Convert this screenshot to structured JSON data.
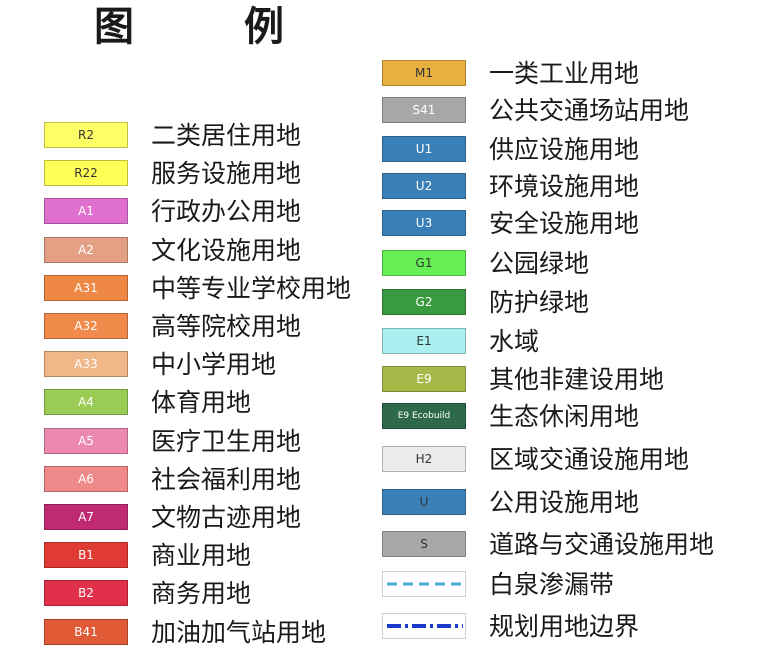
{
  "legend": {
    "title_1": "图",
    "title_2": "例",
    "left_items": [
      {
        "code": "R2",
        "label": "二类居住用地",
        "color": "#ffff66",
        "text_color": "dark"
      },
      {
        "code": "R22",
        "label": "服务设施用地",
        "color": "#ffff55",
        "text_color": "dark"
      },
      {
        "code": "A1",
        "label": "行政办公用地",
        "color": "#e070cf",
        "text_color": "light"
      },
      {
        "code": "A2",
        "label": "文化设施用地",
        "color": "#e4a084",
        "text_color": "light"
      },
      {
        "code": "A31",
        "label": "中等专业学校用地",
        "color": "#ee8844",
        "text_color": "light"
      },
      {
        "code": "A32",
        "label": "高等院校用地",
        "color": "#f08a4a",
        "text_color": "light"
      },
      {
        "code": "A33",
        "label": "中小学用地",
        "color": "#f0b888",
        "text_color": "light"
      },
      {
        "code": "A4",
        "label": "体育用地",
        "color": "#9acc55",
        "text_color": "light"
      },
      {
        "code": "A5",
        "label": "医疗卫生用地",
        "color": "#ec88b0",
        "text_color": "light"
      },
      {
        "code": "A6",
        "label": "社会福利用地",
        "color": "#f08a8a",
        "text_color": "light"
      },
      {
        "code": "A7",
        "label": "文物古迹用地",
        "color": "#c02a70",
        "text_color": "light"
      },
      {
        "code": "B1",
        "label": "商业用地",
        "color": "#e03a35",
        "text_color": "light"
      },
      {
        "code": "B2",
        "label": "商务用地",
        "color": "#e0304a",
        "text_color": "light"
      },
      {
        "code": "B41",
        "label": "加油加气站用地",
        "color": "#e05a35",
        "text_color": "light"
      }
    ],
    "right_items": [
      {
        "code": "M1",
        "label": "一类工业用地",
        "color": "#e8b040",
        "text_color": "dark",
        "kind": "fill"
      },
      {
        "code": "S41",
        "label": "公共交通场站用地",
        "color": "#a8a8a8",
        "text_color": "light",
        "kind": "fill"
      },
      {
        "code": "U1",
        "label": "供应设施用地",
        "color": "#3a80b8",
        "text_color": "light",
        "kind": "fill"
      },
      {
        "code": "U2",
        "label": "环境设施用地",
        "color": "#3a80b8",
        "text_color": "light",
        "kind": "fill"
      },
      {
        "code": "U3",
        "label": "安全设施用地",
        "color": "#3a80b8",
        "text_color": "light",
        "kind": "fill"
      },
      {
        "code": "G1",
        "label": "公园绿地",
        "color": "#66ee55",
        "text_color": "dark",
        "kind": "fill"
      },
      {
        "code": "G2",
        "label": "防护绿地",
        "color": "#3a9a40",
        "text_color": "light",
        "kind": "fill"
      },
      {
        "code": "E1",
        "label": "水域",
        "color": "#aaf0f0",
        "text_color": "dark",
        "kind": "fill"
      },
      {
        "code": "E9",
        "label": "其他非建设用地",
        "color": "#a8b848",
        "text_color": "light",
        "kind": "fill"
      },
      {
        "code": "E9 Ecobuild",
        "label": "生态休闲用地",
        "color": "#2e6a4a",
        "text_color": "light",
        "kind": "fill"
      },
      {
        "code": "H2",
        "label": "区域交通设施用地",
        "color": "#ebebeb",
        "text_color": "dark",
        "kind": "fill"
      },
      {
        "code": "U",
        "label": "公用设施用地",
        "color": "#3a80b8",
        "text_color": "dark",
        "kind": "fill"
      },
      {
        "code": "S",
        "label": "道路与交通设施用地",
        "color": "#a8a8a8",
        "text_color": "dark",
        "kind": "fill"
      },
      {
        "code": "",
        "label": "白泉渗漏带",
        "color": "#4aa8d8",
        "text_color": "dark",
        "kind": "dashed"
      },
      {
        "code": "",
        "label": "规划用地边界",
        "color": "#1a3acc",
        "text_color": "dark",
        "kind": "dashdot"
      }
    ]
  }
}
